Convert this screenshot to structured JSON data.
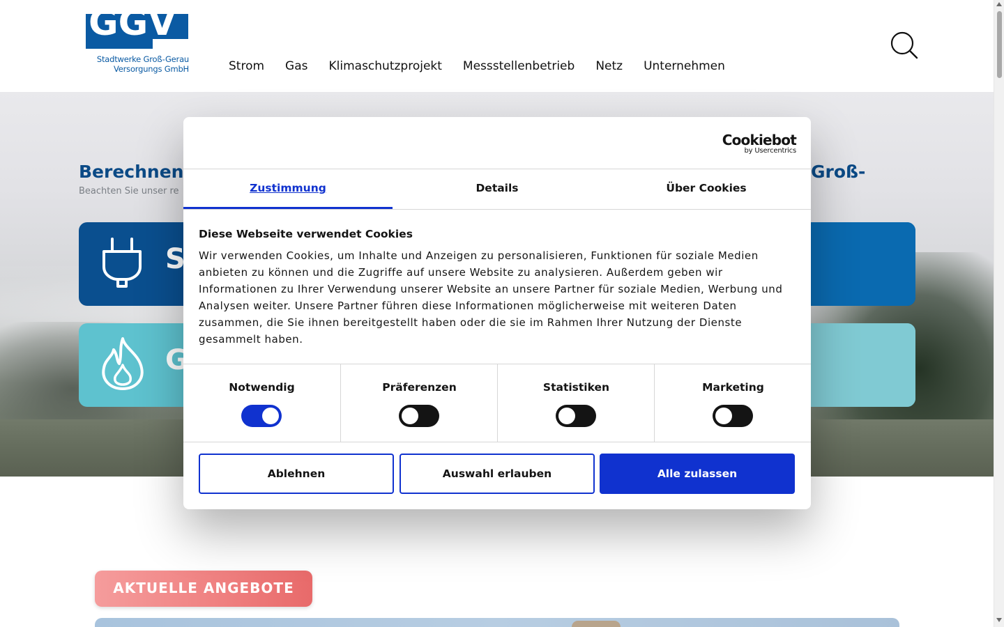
{
  "site": {
    "logo_text": "GGV",
    "logo_subtitle_line1": "Stadtwerke Groß-Gerau",
    "logo_subtitle_line2": "Versorgungs GmbH"
  },
  "nav": {
    "items": [
      {
        "label": "Strom"
      },
      {
        "label": "Gas"
      },
      {
        "label": "Klimaschutzprojekt"
      },
      {
        "label": "Messstellenbetrieb"
      },
      {
        "label": "Netz"
      },
      {
        "label": "Unternehmen"
      }
    ],
    "search_icon": "search-icon"
  },
  "hero": {
    "title_left": "Berechnen",
    "title_right": "Groß-",
    "subtitle": "Beachten Sie unser re",
    "tiles": [
      {
        "label": "S",
        "icon": "plug-icon",
        "color": "#0a4f8f"
      },
      {
        "label": "G",
        "icon": "flame-icon",
        "color": "#5ec2cf"
      }
    ]
  },
  "offers": {
    "badge_label": "AKTUELLE ANGEBOTE"
  },
  "cookie_dialog": {
    "brand": "Cookiebot",
    "brand_sub": "by Usercentrics",
    "tabs": [
      {
        "label": "Zustimmung",
        "active": true
      },
      {
        "label": "Details",
        "active": false
      },
      {
        "label": "Über Cookies",
        "active": false
      }
    ],
    "heading": "Diese Webseite verwendet Cookies",
    "text": "Wir verwenden Cookies, um Inhalte und Anzeigen zu personalisieren, Funktionen für soziale Medien anbieten zu können und die Zugriffe auf unsere Website zu analysieren. Außerdem geben wir Informationen zu Ihrer Verwendung unserer Website an unsere Partner für soziale Medien, Werbung und Analysen weiter. Unsere Partner führen diese Informationen möglicherweise mit weiteren Daten zusammen, die Sie ihnen bereitgestellt haben oder die sie im Rahmen Ihrer Nutzung der Dienste gesammelt haben.",
    "categories": [
      {
        "label": "Notwendig",
        "enabled": true
      },
      {
        "label": "Präferenzen",
        "enabled": false
      },
      {
        "label": "Statistiken",
        "enabled": false
      },
      {
        "label": "Marketing",
        "enabled": false
      }
    ],
    "buttons": {
      "decline": "Ablehnen",
      "allow_selection": "Auswahl erlauben",
      "allow_all": "Alle zulassen"
    },
    "accent_color": "#1032cf"
  }
}
